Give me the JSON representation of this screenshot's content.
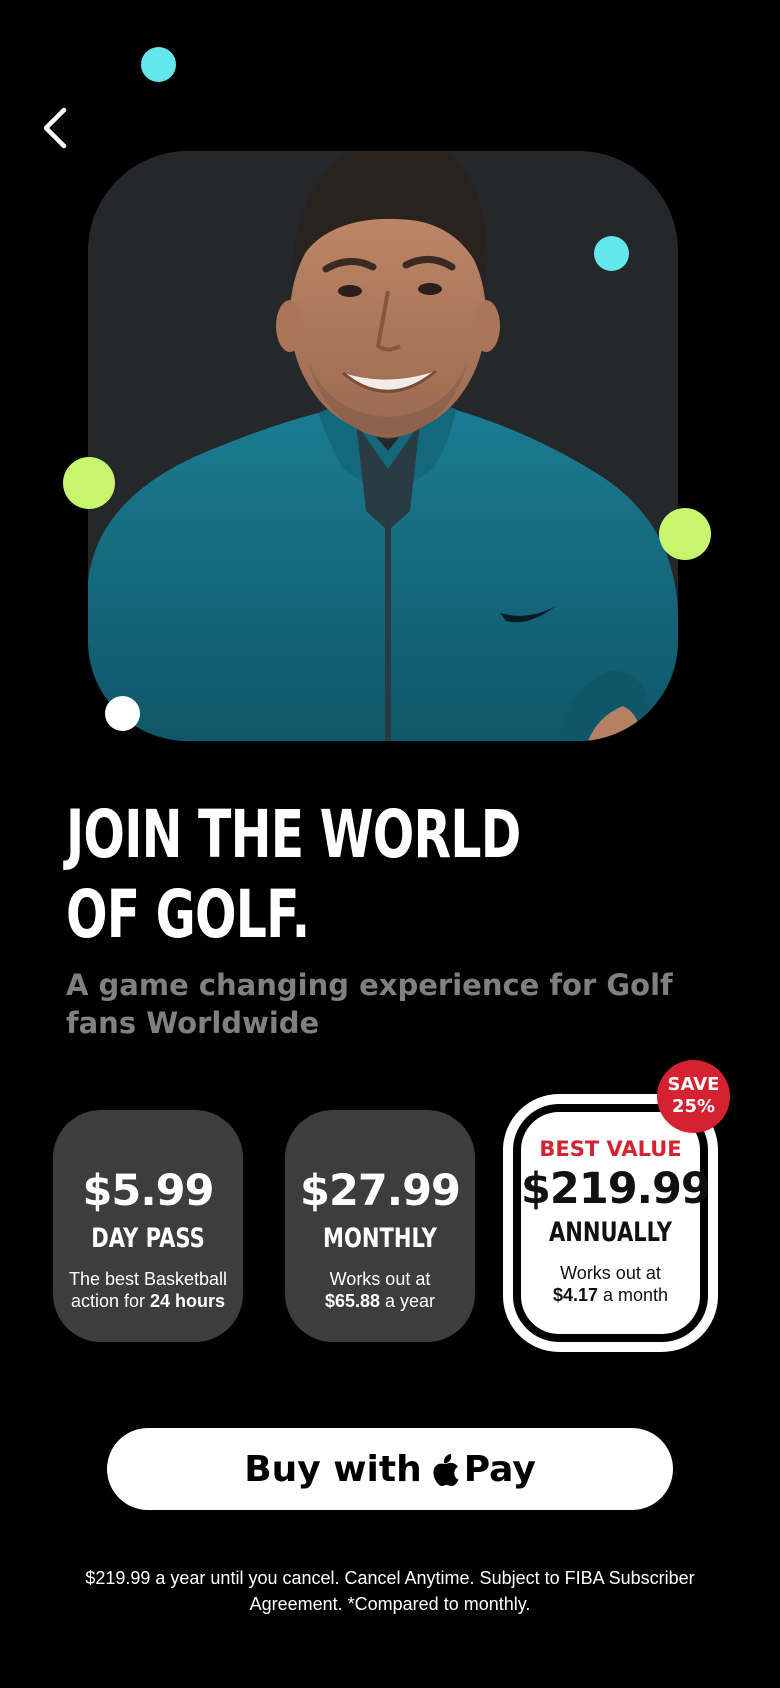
{
  "nav": {
    "back_icon": "chevron-left-icon"
  },
  "hero": {
    "headline_line1": "JOIN THE WORLD",
    "headline_line2": "OF GOLF.",
    "subheadline": "A game changing experience for Golf fans Worldwide"
  },
  "plans": [
    {
      "price": "$5.99",
      "name": "DAY PASS",
      "note_prefix": "The best Basketball action for",
      "note_bold": "24 hours",
      "note_suffix": ""
    },
    {
      "price": "$27.99",
      "name": "MONTHLY",
      "note_prefix": "Works out at",
      "note_bold": "$65.88",
      "note_suffix": "a year"
    },
    {
      "price": "$219.99",
      "name": "ANNUALLY",
      "note_prefix": "Works out at",
      "note_bold": "$4.17",
      "note_suffix": "a month",
      "highlight": "BEST VALUE",
      "selected": true
    }
  ],
  "save_badge": {
    "line1": "SAVE",
    "line2": "25%"
  },
  "buy_button": {
    "label": "Buy with",
    "pay_label": "Pay",
    "icon": "apple-logo-icon"
  },
  "legal": "$219.99 a year until you cancel. Cancel Anytime. Subject to FIBA Subscriber Agreement. *Compared to monthly.",
  "colors": {
    "background": "#000000",
    "card": "#3d3d3d",
    "accent_red": "#d42230",
    "dot_cyan": "#63e6ec",
    "dot_lime": "#c8f56e",
    "subtitle_gray": "#808080"
  }
}
